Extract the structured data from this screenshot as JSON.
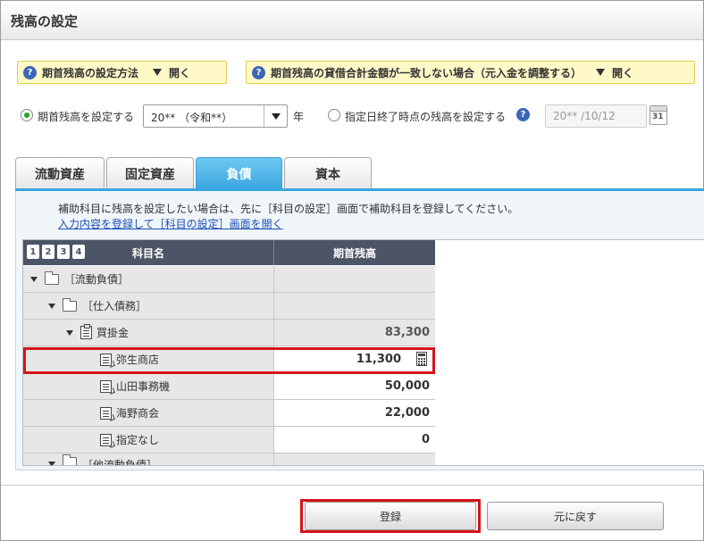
{
  "window": {
    "title": "残高の設定"
  },
  "help": [
    {
      "label": "期首残高の設定方法",
      "action": "開く"
    },
    {
      "label": "期首残高の貸借合計金額が一致しない場合（元入金を調整する）",
      "action": "開く"
    }
  ],
  "options": {
    "radio1_label": "期首残高を設定する",
    "year_value": "20** （令和**）",
    "year_unit": "年",
    "radio2_label": "指定日終了時点の残高を設定する",
    "date_value": "20** /10/12",
    "calendar_number": "31"
  },
  "tabs": [
    {
      "label": "流動資産",
      "active": false
    },
    {
      "label": "固定資産",
      "active": false
    },
    {
      "label": "負債",
      "active": true
    },
    {
      "label": "資本",
      "active": false
    }
  ],
  "notice": {
    "text": "補助科目に残高を設定したい場合は、先に［科目の設定］画面で補助科目を登録してください。",
    "link": "入力内容を登録して［科目の設定］画面を開く"
  },
  "grid": {
    "levels": [
      "1",
      "2",
      "3",
      "4"
    ],
    "col_name": "科目名",
    "col_balance": "期首残高",
    "rows": [
      {
        "name": "［流動負債］",
        "value": ""
      },
      {
        "name": "［仕入債務］",
        "value": ""
      },
      {
        "name": "買掛金",
        "value": "83,300"
      },
      {
        "name": "弥生商店",
        "value": "11,300"
      },
      {
        "name": "山田事務機",
        "value": "50,000"
      },
      {
        "name": "海野商会",
        "value": "22,000"
      },
      {
        "name": "指定なし",
        "value": "0"
      },
      {
        "name": "［他流動負債］",
        "value": ""
      }
    ]
  },
  "footer": {
    "register_label": "登録",
    "back_label": "元に戻す"
  },
  "colors": {
    "accent_tab": "#3aa6e0",
    "highlight": "#d4141a",
    "help_bg": "#fff9c8",
    "radio_on": "#22aa22"
  }
}
